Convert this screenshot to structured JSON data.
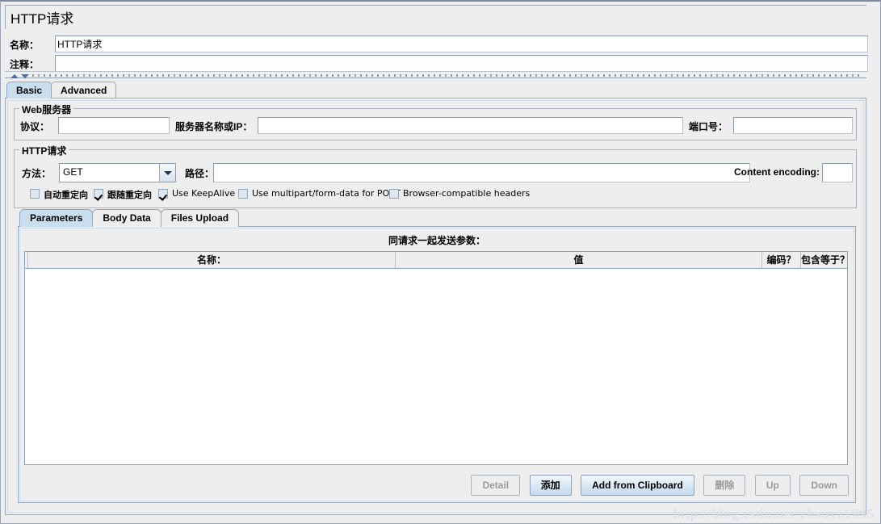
{
  "window": {
    "title": "HTTP请求"
  },
  "header": {
    "name_label": "名称：",
    "name_value": "HTTP请求",
    "comment_label": "注释：",
    "comment_value": ""
  },
  "divider": {
    "collapse_up_icon": "triangle-up-icon",
    "collapse_down_icon": "triangle-down-icon"
  },
  "main_tabs": [
    {
      "label": "Basic",
      "selected": true
    },
    {
      "label": "Advanced",
      "selected": false
    }
  ],
  "web_server": {
    "group_title": "Web服务器",
    "protocol_label": "协议：",
    "protocol_value": "",
    "server_label": "服务器名称或IP：",
    "server_value": "",
    "port_label": "端口号：",
    "port_value": ""
  },
  "http_request": {
    "group_title": "HTTP请求",
    "method_label": "方法：",
    "method_value": "GET",
    "method_dropdown_icon": "chevron-down-icon",
    "path_label": "路径：",
    "path_value": "",
    "content_encoding_label": "Content encoding:",
    "content_encoding_value": "",
    "checkboxes": [
      {
        "label": "自动重定向",
        "checked": false,
        "cjk": true
      },
      {
        "label": "跟随重定向",
        "checked": true,
        "cjk": true
      },
      {
        "label": "Use KeepAlive",
        "checked": true,
        "cjk": false
      },
      {
        "label": "Use multipart/form-data for POST",
        "checked": false,
        "cjk": false
      },
      {
        "label": "Browser-compatible headers",
        "checked": false,
        "cjk": false
      }
    ]
  },
  "sub_tabs": [
    {
      "label": "Parameters",
      "selected": true
    },
    {
      "label": "Body Data",
      "selected": false
    },
    {
      "label": "Files Upload",
      "selected": false
    }
  ],
  "parameters_panel": {
    "caption": "同请求一起发送参数：",
    "columns": [
      "",
      "名称：",
      "值",
      "编码？",
      "包含等于？"
    ],
    "rows": []
  },
  "buttons": [
    {
      "label": "Detail",
      "enabled": false,
      "cjk": false
    },
    {
      "label": "添加",
      "enabled": true,
      "cjk": true
    },
    {
      "label": "Add from Clipboard",
      "enabled": true,
      "cjk": false
    },
    {
      "label": "删除",
      "enabled": false,
      "cjk": true
    },
    {
      "label": "Up",
      "enabled": false,
      "cjk": false
    },
    {
      "label": "Down",
      "enabled": false,
      "cjk": false
    }
  ],
  "watermark": {
    "text": "http://blog.csdn.net/zhaoxz1995"
  }
}
